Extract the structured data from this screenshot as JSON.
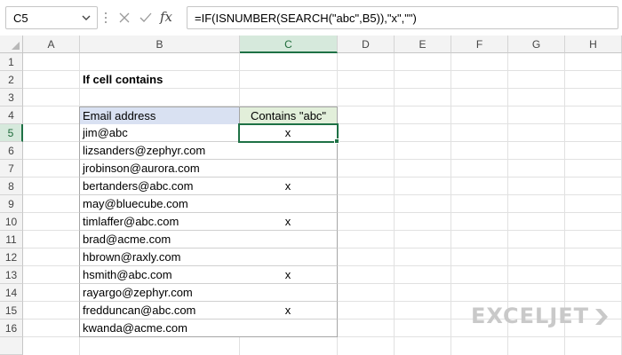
{
  "formula_bar": {
    "name_box": "C5",
    "fx_label": "fx",
    "formula": "=IF(ISNUMBER(SEARCH(\"abc\",B5)),\"x\",\"\")"
  },
  "sheet": {
    "columns": [
      "A",
      "B",
      "C",
      "D",
      "E",
      "F",
      "G",
      "H"
    ],
    "rows": [
      "1",
      "2",
      "3",
      "4",
      "5",
      "6",
      "7",
      "8",
      "9",
      "10",
      "11",
      "12",
      "13",
      "14",
      "15",
      "16"
    ],
    "selected_column": "C",
    "selected_row": "5",
    "title": "If cell contains",
    "table": {
      "headers": [
        "Email address",
        "Contains \"abc\""
      ],
      "emails": [
        "jim@abc",
        "lizsanders@zephyr.com",
        "jrobinson@aurora.com",
        "bertanders@abc.com",
        "may@bluecube.com",
        "timlaffer@abc.com",
        "brad@acme.com",
        "hbrown@raxly.com",
        "hsmith@abc.com",
        "rayargo@zephyr.com",
        "fredduncan@abc.com",
        "kwanda@acme.com"
      ],
      "results": [
        "x",
        "",
        "",
        "x",
        "",
        "x",
        "",
        "",
        "x",
        "",
        "x",
        ""
      ]
    }
  },
  "logo": {
    "text": "EXCELJET"
  },
  "colors": {
    "accent": "#1e7145",
    "header_blue": "#d9e1f2",
    "header_green": "#e2efda"
  }
}
